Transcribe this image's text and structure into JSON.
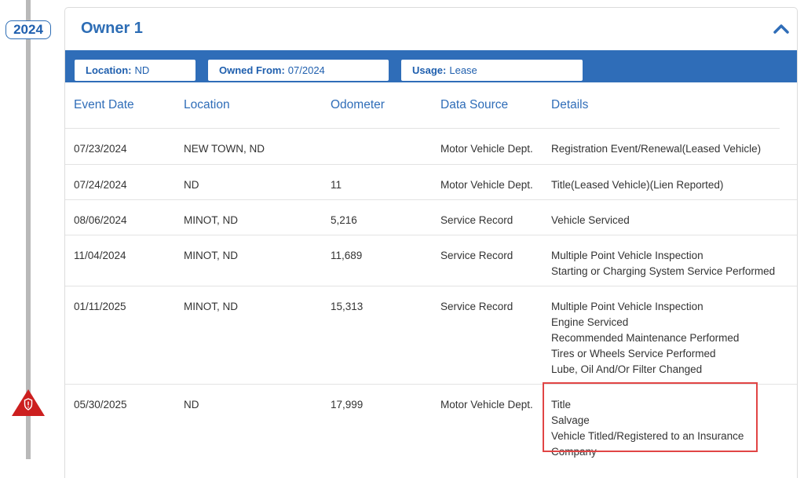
{
  "timeline": {
    "year": "2024"
  },
  "owner": {
    "title": "Owner 1",
    "location_label": "Location:",
    "location_value": "ND",
    "owned_label": "Owned From:",
    "owned_value": "07/2024",
    "usage_label": "Usage:",
    "usage_value": "Lease"
  },
  "table": {
    "headers": {
      "date": "Event Date",
      "location": "Location",
      "odometer": "Odometer",
      "source": "Data Source",
      "details": "Details"
    },
    "rows": [
      {
        "date": "07/23/2024",
        "location": "NEW TOWN, ND",
        "odometer": "",
        "source": "Motor Vehicle Dept.",
        "details": [
          "Registration Event/Renewal(Leased Vehicle)"
        ]
      },
      {
        "date": "07/24/2024",
        "location": "ND",
        "odometer": "11",
        "source": "Motor Vehicle Dept.",
        "details": [
          "Title(Leased Vehicle)(Lien Reported)"
        ]
      },
      {
        "date": "08/06/2024",
        "location": "MINOT, ND",
        "odometer": "5,216",
        "source": "Service Record",
        "details": [
          "Vehicle Serviced"
        ]
      },
      {
        "date": "11/04/2024",
        "location": "MINOT, ND",
        "odometer": "11,689",
        "source": "Service Record",
        "details": [
          "Multiple Point Vehicle Inspection",
          "Starting or Charging System Service Performed"
        ]
      },
      {
        "date": "01/11/2025",
        "location": "MINOT, ND",
        "odometer": "15,313",
        "source": "Service Record",
        "details": [
          "Multiple Point Vehicle Inspection",
          "Engine Serviced",
          "Recommended Maintenance Performed",
          "Tires or Wheels Service Performed",
          "Lube, Oil And/Or Filter Changed"
        ]
      },
      {
        "date": "05/30/2025",
        "location": "ND",
        "odometer": "17,999",
        "source": "Motor Vehicle Dept.",
        "details": [
          "Title",
          "Salvage",
          "Vehicle Titled/Registered to an Insurance",
          "Company"
        ]
      }
    ]
  },
  "colors": {
    "accent": "#2f6db8",
    "alert": "#cc1f1f",
    "highlight": "#e14545"
  }
}
